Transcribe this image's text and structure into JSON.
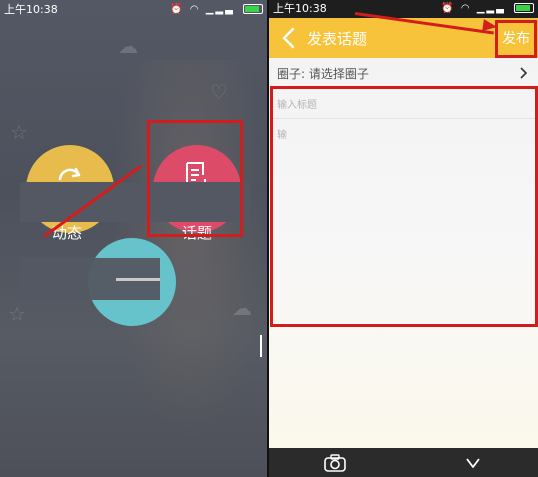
{
  "left_screen": {
    "status_time": "上午10:38",
    "menu": {
      "dynamic_label": "动态",
      "topic_label": "话题"
    }
  },
  "right_screen": {
    "status_time": "上午10:38",
    "header": {
      "title": "发表话题",
      "publish_label": "发布"
    },
    "form": {
      "circle_label": "圈子:  请选择圈子",
      "title_placeholder": "输入标题",
      "body_placeholder": "输"
    },
    "bottom": {
      "icons": [
        "camera-icon",
        "chevron-down-icon"
      ]
    }
  },
  "colors": {
    "accent_yellow": "#f7c33a",
    "dynamic_yellow": "#e8bc4c",
    "topic_pink": "#dc4b68",
    "teal": "#66c3cc",
    "annotation_red": "#d31d1d"
  }
}
